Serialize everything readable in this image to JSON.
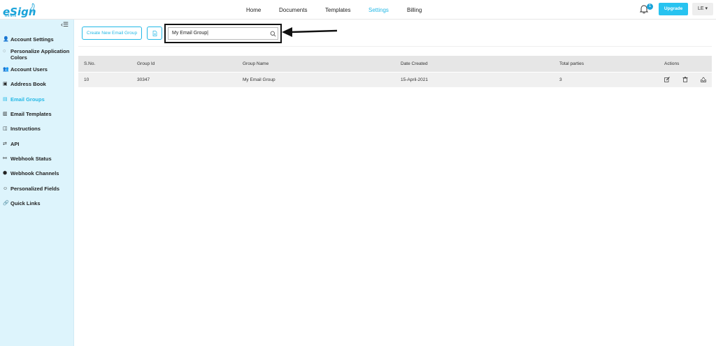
{
  "brand": {
    "name": "eSign",
    "sub": "GENIE"
  },
  "nav": {
    "items": [
      "Home",
      "Documents",
      "Templates",
      "Settings",
      "Billing"
    ],
    "active": "Settings"
  },
  "header": {
    "notification_count": "1",
    "upgrade_label": "Upgrade",
    "user_initials": "LE ▾"
  },
  "sidebar": {
    "collapse_icon": "‹☰",
    "items": [
      {
        "label": "Account Settings",
        "icon": "user-gear-icon"
      },
      {
        "label": "Personalize Application Colors",
        "line1": "Personalize Application",
        "line2": "Colors",
        "icon": "palette-icon"
      },
      {
        "label": "Account Users",
        "icon": "users-icon"
      },
      {
        "label": "Address Book",
        "icon": "address-book-icon"
      },
      {
        "label": "Email Groups",
        "icon": "email-groups-icon",
        "active": true
      },
      {
        "label": "Email Templates",
        "icon": "email-template-icon"
      },
      {
        "label": "Instructions",
        "icon": "instructions-icon"
      },
      {
        "label": "API",
        "icon": "api-icon"
      },
      {
        "label": "Webhook Status",
        "icon": "webhook-status-icon"
      },
      {
        "label": "Webhook Channels",
        "icon": "webhook-channels-icon"
      },
      {
        "label": "Personalized Fields",
        "icon": "personalized-fields-icon"
      },
      {
        "label": "Quick Links",
        "icon": "link-icon"
      }
    ]
  },
  "toolbar": {
    "create_label": "Create New Email Group",
    "export_icon": "document-icon"
  },
  "search": {
    "value": "My Email Group|"
  },
  "table": {
    "columns": [
      "S.No.",
      "Group Id",
      "Group Name",
      "Date Created",
      "Total parties",
      "Actions"
    ],
    "rows": [
      {
        "sno": "10",
        "group_id": "30347",
        "group_name": "My Email Group",
        "date_created": "15-April-2021",
        "total_parties": "3"
      }
    ]
  },
  "colors": {
    "accent": "#23b8e6",
    "sidebar_bg": "#ddf4fc",
    "header_row": "#e6e6e6"
  }
}
